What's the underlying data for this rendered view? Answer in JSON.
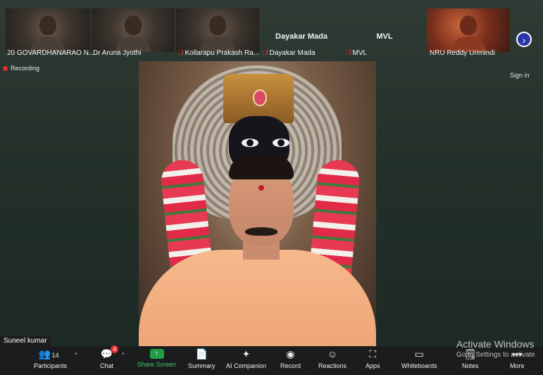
{
  "participants": [
    {
      "name": "20 GOVARDHANARAO N...",
      "muted": false
    },
    {
      "name": "Dr Aruna Jyothi",
      "muted": false
    },
    {
      "name": "Kollarapu Prakash Ra...",
      "muted": true
    },
    {
      "name": "Dayakar Mada",
      "muted": true,
      "display": "Dayakar Mada"
    },
    {
      "name": "MVL",
      "muted": true,
      "display": "MVL"
    },
    {
      "name": "NRU Reddy Urimindi",
      "muted": false
    }
  ],
  "next_icon": "chevron-right",
  "recording_label": "Recording",
  "sign_in_label": "Sign in",
  "active_speaker": "Suneel kumar",
  "toolbar": {
    "participants_label": "Participants",
    "participants_count": "14",
    "chat_label": "Chat",
    "chat_badge": "4",
    "share_label": "Share Screen",
    "summary_label": "Summary",
    "ai_label": "AI Companion",
    "record_label": "Record",
    "reactions_label": "Reactions",
    "apps_label": "Apps",
    "whiteboards_label": "Whiteboards",
    "notes_label": "Notes",
    "more_label": "More"
  },
  "watermark": {
    "title": "Activate Windows",
    "subtitle": "Go to Settings to activate"
  },
  "colors": {
    "share_green": "#1f9e45",
    "record_red": "#e0322f",
    "next_blue": "#2b36a8"
  }
}
